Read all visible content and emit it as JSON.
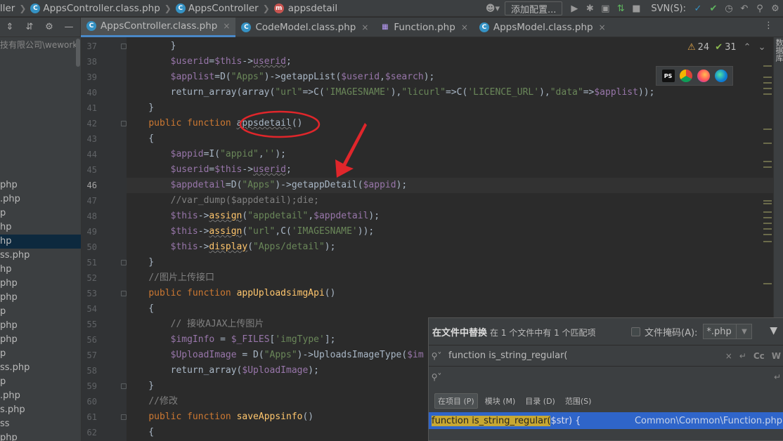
{
  "navbar": {
    "crumb_prefix": "ller",
    "crumb_file": "AppsController.class.php",
    "crumb_class": "AppsController",
    "crumb_method": "appsdetail",
    "add_config": "添加配置...",
    "svn_label": "SVN(S):"
  },
  "tabs": [
    {
      "label": "AppsController.class.php",
      "icon": "class-c-icon",
      "active": true
    },
    {
      "label": "CodeModel.class.php",
      "icon": "class-c-icon",
      "active": false
    },
    {
      "label": "Function.php",
      "icon": "php-file-icon",
      "active": false
    },
    {
      "label": "AppsModel.class.php",
      "icon": "class-c-icon",
      "active": false
    }
  ],
  "sidebar": {
    "header": "技有限公司\\wework",
    "items": [
      {
        "label": "php"
      },
      {
        "label": ".php"
      },
      {
        "label": "p"
      },
      {
        "label": "hp"
      },
      {
        "label": "hp",
        "selected": true
      },
      {
        "label": "ss.php"
      },
      {
        "label": "hp"
      },
      {
        "label": "php"
      },
      {
        "label": "php"
      },
      {
        "label": "p"
      },
      {
        "label": "php"
      },
      {
        "label": "php"
      },
      {
        "label": "p"
      },
      {
        "label": "ss.php"
      },
      {
        "label": "p"
      },
      {
        "label": ".php"
      },
      {
        "label": "s.php"
      },
      {
        "label": "ss"
      },
      {
        "label": "php"
      }
    ]
  },
  "inspections": {
    "warnings": "24",
    "ok": "31"
  },
  "browsers": [
    "phpstorm-icon",
    "chrome-icon",
    "firefox-icon",
    "edge-icon"
  ],
  "editor": {
    "current_line": 46,
    "lines": [
      {
        "n": 37,
        "t": "        }"
      },
      {
        "n": 38,
        "t": "        $userid=$this->userid;"
      },
      {
        "n": 39,
        "t": "        $applist=D(\"Apps\")->getappList($userid,$search);"
      },
      {
        "n": 40,
        "t": "        return_array(array(\"url\"=>C('IMAGESNAME'),\"licurl\"=>C('LICENCE_URL'),\"data\"=>$applist));"
      },
      {
        "n": 41,
        "t": "    }"
      },
      {
        "n": 42,
        "t": "    public function appsdetail()"
      },
      {
        "n": 43,
        "t": "    {"
      },
      {
        "n": 44,
        "t": "        $appid=I(\"appid\",'');"
      },
      {
        "n": 45,
        "t": "        $userid=$this->userid;"
      },
      {
        "n": 46,
        "t": "        $appdetail=D(\"Apps\")->getappDetail($appid);"
      },
      {
        "n": 47,
        "t": "        //var_dump($appdetail);die;"
      },
      {
        "n": 48,
        "t": "        $this->assign(\"appdetail\",$appdetail);"
      },
      {
        "n": 49,
        "t": "        $this->assign(\"url\",C('IMAGESNAME'));"
      },
      {
        "n": 50,
        "t": "        $this->display(\"Apps/detail\");"
      },
      {
        "n": 51,
        "t": "    }"
      },
      {
        "n": 52,
        "t": "    //图片上传接口"
      },
      {
        "n": 53,
        "t": "    public function appUploadsimgApi()"
      },
      {
        "n": 54,
        "t": "    {"
      },
      {
        "n": 55,
        "t": "        // 接收AJAX上传图片"
      },
      {
        "n": 56,
        "t": "        $imgInfo = $_FILES['imgType'];"
      },
      {
        "n": 57,
        "t": "        $UploadImage = D(\"Apps\")->UploadsImageType($im"
      },
      {
        "n": 58,
        "t": "        return_array($UploadImage);"
      },
      {
        "n": 59,
        "t": "    }"
      },
      {
        "n": 60,
        "t": "    //修改"
      },
      {
        "n": 61,
        "t": "    public function saveAppsinfo()"
      },
      {
        "n": 62,
        "t": "    {"
      }
    ]
  },
  "find_panel": {
    "title": "在文件中替换",
    "subtitle": "在 1 个文件中有 1 个匹配项",
    "file_mask_label": "文件掩码(A):",
    "file_mask_value": "*.php",
    "search_text": "function is_string_regular(",
    "replace_text": "",
    "scopes": [
      {
        "label": "在项目 (P)",
        "active": true
      },
      {
        "label": "模块 (M)",
        "active": false
      },
      {
        "label": "目录 (D)",
        "active": false
      },
      {
        "label": "范围(S)",
        "active": false
      }
    ],
    "cc_label": "Cc",
    "w_label": "W",
    "result": {
      "match": "function is_string_regular(",
      "rest": "$str) {",
      "path": "Common\\Common\\Function.php"
    }
  },
  "right_tool": "数据库"
}
